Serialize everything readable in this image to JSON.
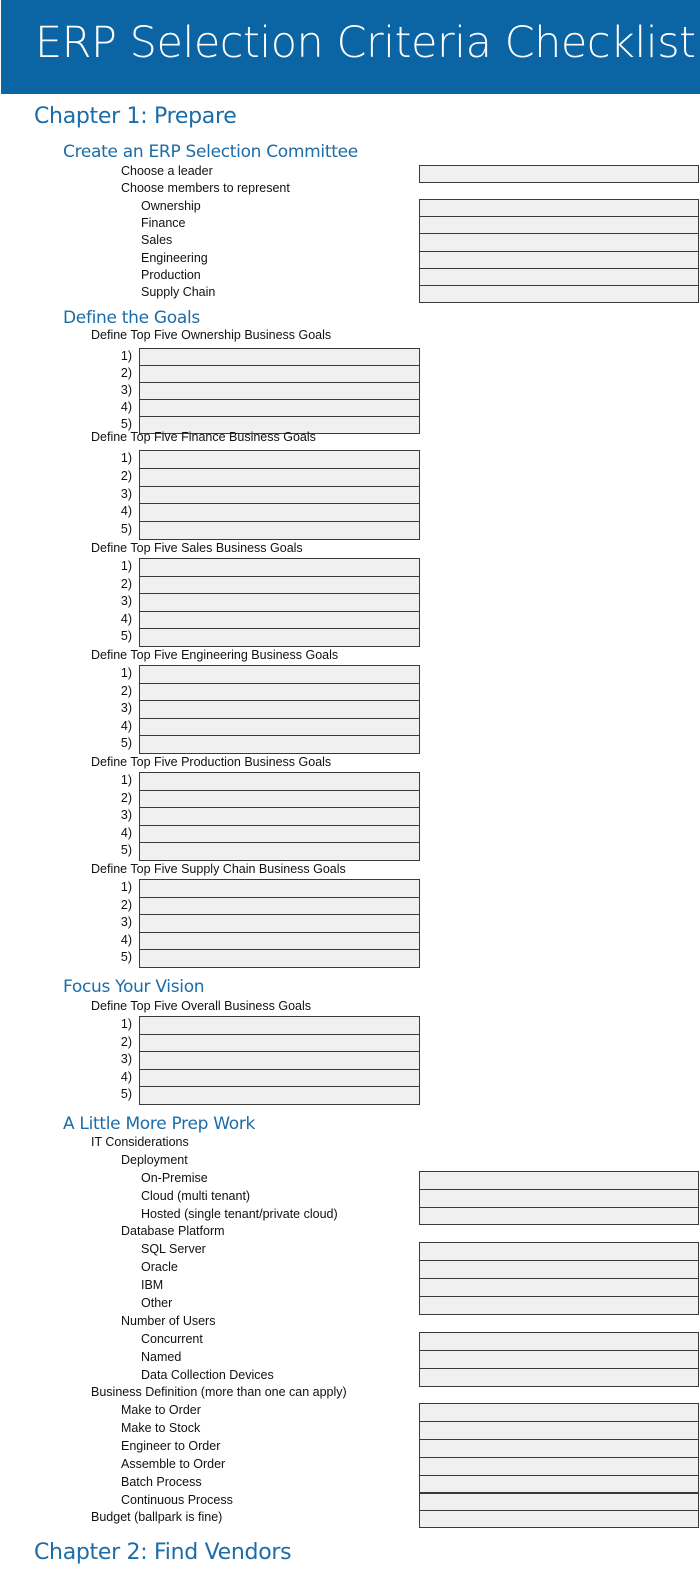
{
  "title": "ERP Selection Criteria Checklist",
  "colors": {
    "banner": "#0b64a3",
    "heading": "#1b6ca8",
    "field_fill": "#f0f0f0",
    "field_border": "#3a3a3a"
  },
  "chapter1": {
    "title": "Chapter 1: Prepare",
    "committee": {
      "title": "Create an ERP Selection Committee",
      "leader_label": "Choose a leader",
      "members_label": "Choose members to represent",
      "members": [
        "Ownership",
        "Finance",
        "Sales",
        "Engineering",
        "Production",
        "Supply Chain"
      ]
    },
    "goals": {
      "title": "Define the Goals",
      "groups": [
        {
          "label": "Define Top Five Ownership Business Goals"
        },
        {
          "label": "Define Top Five Finance Business Goals"
        },
        {
          "label": "Define Top Five Sales Business Goals"
        },
        {
          "label": "Define Top Five Engineering Business Goals"
        },
        {
          "label": "Define Top Five Production Business Goals"
        },
        {
          "label": "Define Top Five Supply Chain Business Goals"
        }
      ],
      "numbers": [
        "1)",
        "2)",
        "3)",
        "4)",
        "5)"
      ]
    },
    "vision": {
      "title": "Focus Your Vision",
      "label": "Define Top Five Overall Business Goals"
    },
    "prep": {
      "title": "A Little More Prep Work",
      "it_label": "IT Considerations",
      "deployment": {
        "label": "Deployment",
        "items": [
          "On-Premise",
          "Cloud (multi tenant)",
          "Hosted (single tenant/private cloud)"
        ]
      },
      "database": {
        "label": "Database Platform",
        "items": [
          "SQL Server",
          "Oracle",
          "IBM",
          "Other"
        ]
      },
      "users": {
        "label": "Number of Users",
        "items": [
          "Concurrent",
          "Named",
          "Data Collection Devices"
        ]
      },
      "business": {
        "label": "Business Definition (more than one can apply)",
        "items": [
          "Make to Order",
          "Make to Stock",
          "Engineer to Order",
          "Assemble to Order",
          "Batch Process",
          "Continuous Process"
        ]
      },
      "budget_label": "Budget (ballpark is fine)"
    }
  },
  "chapter2": {
    "title": "Chapter 2: Find Vendors"
  }
}
